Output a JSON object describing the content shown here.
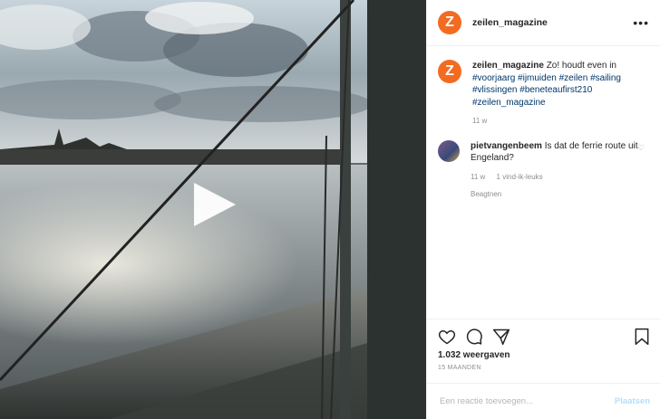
{
  "post": {
    "username": "zeilen_magazine",
    "avatar_letter": "Z",
    "brand_color": "#f26b21",
    "more_icon": "•••"
  },
  "caption": {
    "username": "zeilen_magazine",
    "text": "Zo! houdt even in",
    "hashtags": "#voorjaarg #ijmuiden #zeilen #sailing #vlissingen #beneteaufirst210 #zeilen_magazine",
    "age": "11 w"
  },
  "comment": {
    "username": "pietvangenbeem",
    "text": "Is dat de ferrie route uit Engeland?",
    "age": "11 w",
    "likes": "1 vind-ik-leuks",
    "reply": "Beagtnen"
  },
  "stats": {
    "views": "1.032 weergaven",
    "date": "15 MAANDEN"
  },
  "comment_box": {
    "placeholder": "Een reactie toevoegen...",
    "post_label": "Plaatsen"
  }
}
